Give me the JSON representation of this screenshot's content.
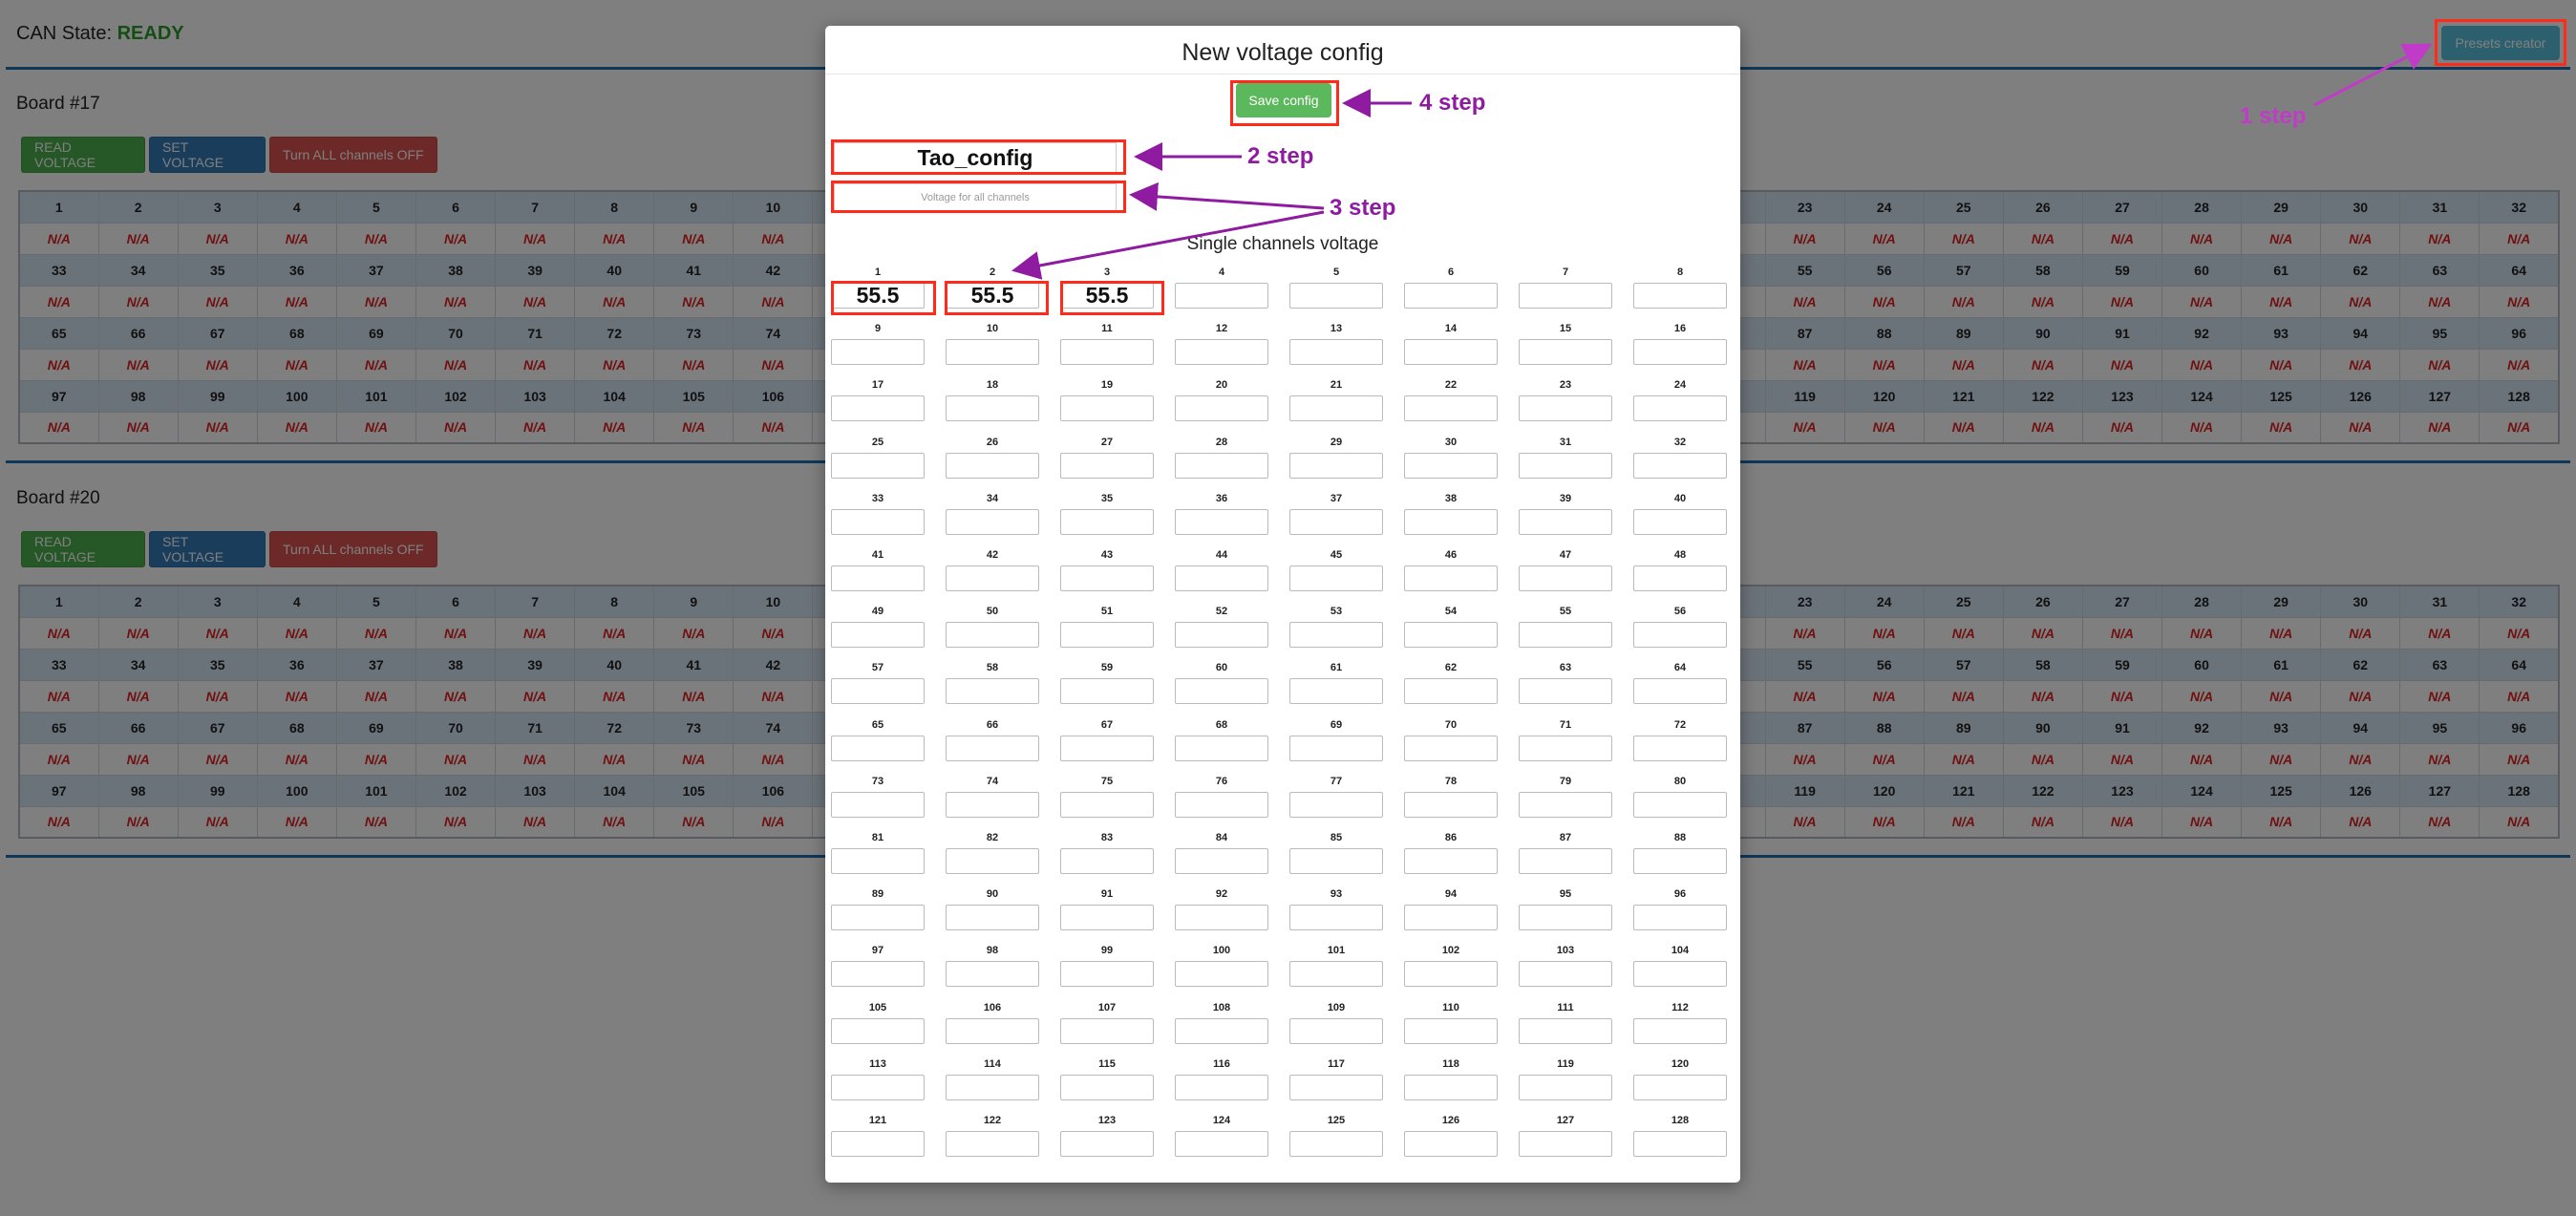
{
  "header": {
    "state_label": "CAN State:",
    "state_value": "READY",
    "presets_button": "Presets creator"
  },
  "boards": [
    {
      "title": "Board #17",
      "buttons": {
        "read": "READ VOLTAGE",
        "set": "SET VOLTAGE",
        "off": "Turn ALL channels OFF"
      },
      "na_value": "N/A"
    },
    {
      "title": "Board #20",
      "buttons": {
        "read": "READ VOLTAGE",
        "set": "SET VOLTAGE",
        "off": "Turn ALL channels OFF"
      },
      "na_value": "N/A"
    }
  ],
  "modal": {
    "title": "New voltage config",
    "save_button": "Save config",
    "config_name_value": "Tao_config",
    "all_voltage_placeholder": "Voltage for all channels",
    "single_title": "Single channels voltage",
    "channel_count": 128,
    "channel_values": {
      "1": "55.5",
      "2": "55.5",
      "3": "55.5"
    }
  },
  "annotations": {
    "step1": "1 step",
    "step2": "2 step",
    "step3": "3 step",
    "step4": "4 step",
    "highlight_color": "#ff2a1a",
    "arrow_color": "#8e1ba0"
  }
}
